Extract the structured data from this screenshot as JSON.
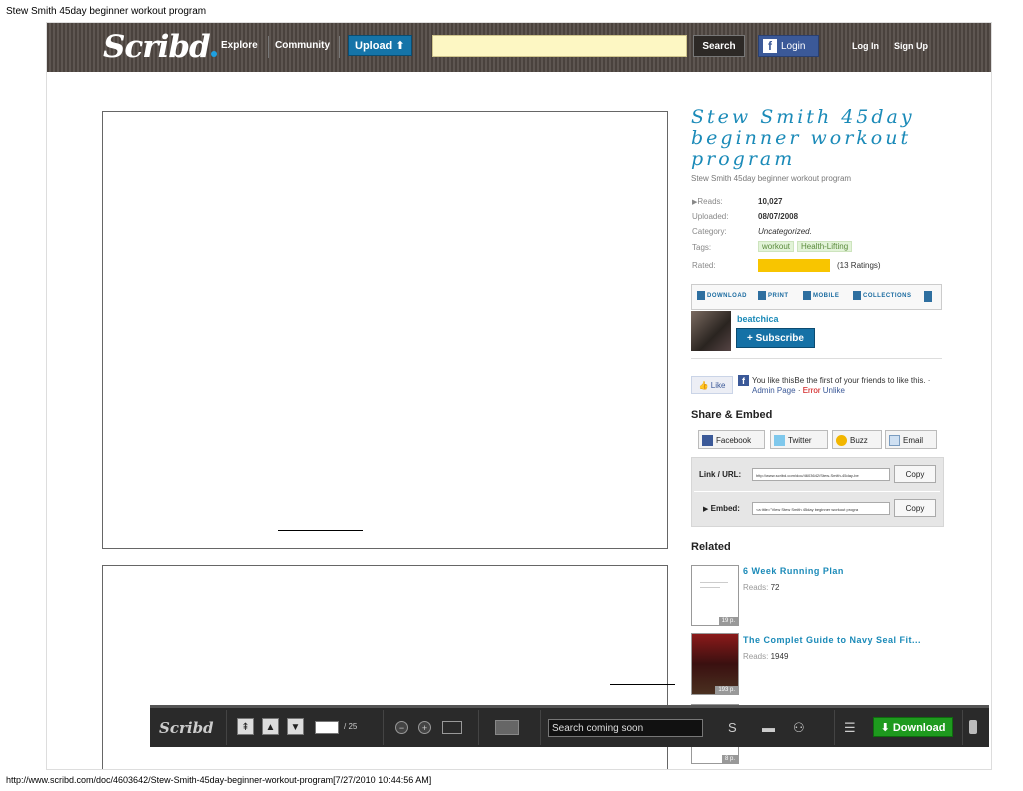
{
  "window": {
    "title": "Stew Smith 45day beginner workout program",
    "footer_url": "http://www.scribd.com/doc/4603642/Stew-Smith-45day-beginner-workout-program[7/27/2010 10:44:56 AM]"
  },
  "header": {
    "logo": "Scribd",
    "nav": [
      "Explore",
      "Community"
    ],
    "upload_label": "Upload",
    "search_value": "",
    "search_button": "Search",
    "fb_login": "Login",
    "log_in": "Log In",
    "sign_up": "Sign Up",
    "colors": {
      "bar": "#4a423d",
      "upload": "#1574a8",
      "search_bg": "#fdf7c3",
      "facebook": "#3b5998"
    }
  },
  "doc": {
    "title": "Stew Smith 45day beginner workout program",
    "subtitle": "Stew Smith 45day beginner workout program",
    "meta": {
      "reads_label": "Reads:",
      "reads": "10,027",
      "uploaded_label": "Uploaded:",
      "uploaded": "08/07/2008",
      "category_label": "Category:",
      "category": "Uncategorized.",
      "tags_label": "Tags:",
      "tags": [
        "workout",
        "Health-Lifting"
      ],
      "rated_label": "Rated:",
      "ratings": "(13 Ratings)"
    },
    "actions": [
      "DOWNLOAD",
      "PRINT",
      "MOBILE",
      "COLLECTIONS"
    ],
    "author": "beatchica",
    "subscribe": "Subscribe"
  },
  "like": {
    "button": "Like",
    "text_pre": "You like thisBe the first of your friends to like this. · ",
    "admin": "Admin Page",
    "sep": " · ",
    "error": "Error",
    "unlike": "Unlike"
  },
  "share": {
    "heading": "Share & Embed",
    "buttons": [
      "Facebook",
      "Twitter",
      "Buzz",
      "Email"
    ],
    "link_label": "Link / URL:",
    "link_value": "http://www.scribd.com/doc/4603642/Stew-Smith-45day-be",
    "embed_label": "Embed:",
    "embed_value": "<a title=\"View Stew Smith 45day beginner workout progra",
    "copy": "Copy"
  },
  "related": {
    "heading": "Related",
    "items": [
      {
        "title": "6 Week Running Plan",
        "reads_label": "Reads:",
        "reads": "72",
        "pages": "19 p."
      },
      {
        "title": "The Complet Guide to Navy Seal Fit...",
        "reads_label": "Reads:",
        "reads": "1949",
        "pages": "193 p."
      },
      {
        "title": "",
        "reads_label": "",
        "reads": "",
        "pages": "8 p."
      }
    ]
  },
  "toolbar": {
    "logo": "Scribd",
    "page_current": "",
    "page_total": "/ 25",
    "search_placeholder": "Search coming soon",
    "download": "Download"
  }
}
